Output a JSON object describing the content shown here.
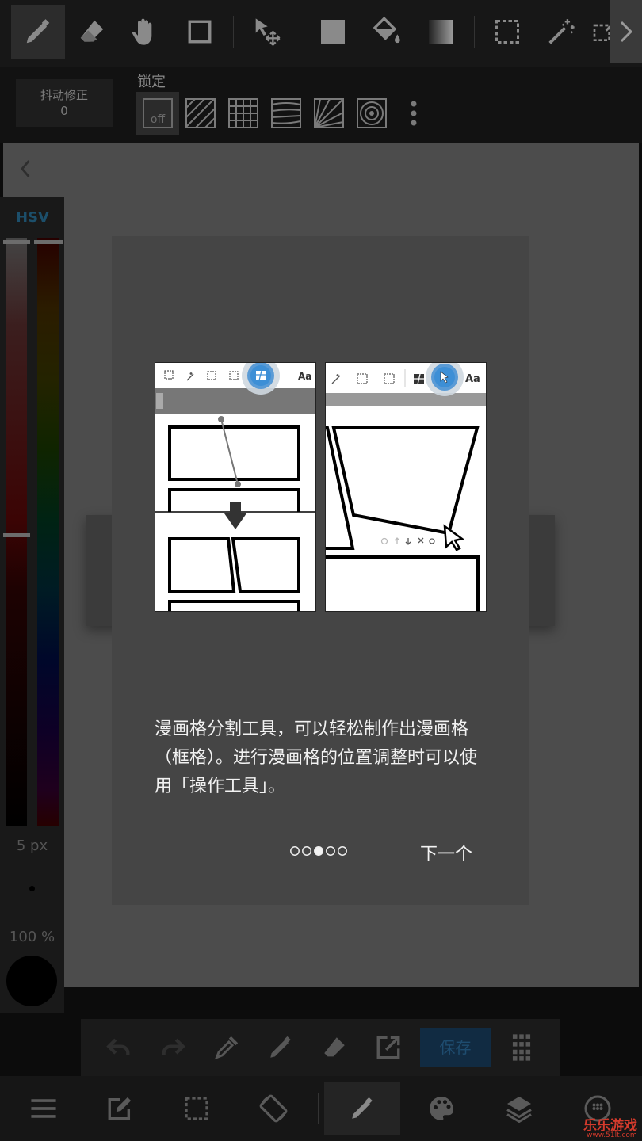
{
  "toolbar": {
    "tools": [
      "pen-tool",
      "eraser-tool",
      "hand-tool",
      "rect-tool",
      "move-tool",
      "fill-color-tool",
      "bucket-tool",
      "gradient-tool",
      "select-tool",
      "magic-wand-tool",
      "select-pen-tool"
    ]
  },
  "sub_toolbar": {
    "stabilizer_label": "抖动修正",
    "stabilizer_value": "0",
    "lock_label": "锁定",
    "ruler_off_label": "off"
  },
  "color_panel": {
    "mode_label": "HSV",
    "brush_size": "5 px",
    "opacity": "100 %",
    "current_color": "#000000"
  },
  "dialog": {
    "illustration_left": {
      "toolbar_text": "Aa"
    },
    "illustration_right": {
      "toolbar_text": "Aa"
    },
    "description": "漫画格分割工具，可以轻松制作出漫画格（框格）。进行漫画格的位置调整时可以使用「操作工具」。",
    "page_count": 5,
    "current_page": 3,
    "next_label": "下一个"
  },
  "action_bar": {
    "save_label": "保存"
  },
  "watermark": {
    "text": "乐乐游戏",
    "url": "www.51lt.com"
  },
  "colors": {
    "accent": "#3d8fd6",
    "dialog_bg": "#454545",
    "canvas_bg": "#4c4c4c"
  }
}
